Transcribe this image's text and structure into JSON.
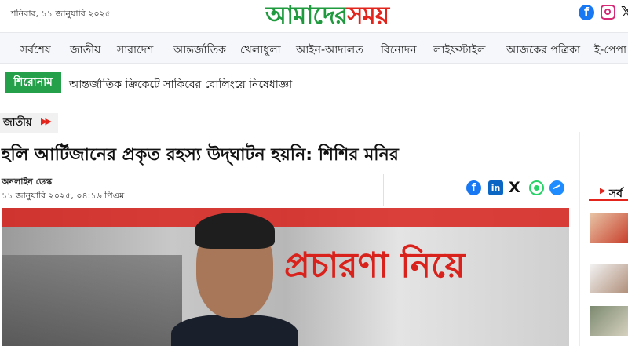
{
  "header": {
    "date": "শনিবার, ১১ জানুয়ারি ২০২৫",
    "logo_part1": "আমাদের",
    "logo_part2": "সময়",
    "social_icons": [
      "facebook-icon",
      "instagram-icon",
      "x-icon"
    ],
    "colors": {
      "logo_green": "#1f9a3e",
      "logo_red": "#e2241c"
    }
  },
  "nav": {
    "items": [
      "সর্বশেষ",
      "জাতীয়",
      "সারাদেশ",
      "আন্তর্জাতিক",
      "খেলাধুলা",
      "আইন-আদালত",
      "বিনোদন",
      "লাইফস্টাইল",
      "আজকের পত্রিকা",
      "ই-পেপা"
    ]
  },
  "ticker": {
    "label": "শিরোনাম",
    "text": "আন্তর্জাতিক ক্রিকেটে সাকিবের বোলিংয়ে নিষেধাজ্ঞা",
    "label_color": "#24a04a"
  },
  "article": {
    "category": "জাতীয়",
    "category_icon": "double-chevron-right-icon",
    "headline": "হলি আর্টিজানের প্রকৃত রহস্য উদ্‌ঘাটন হয়নি: শিশির মনির",
    "author": "অনলাইন ডেস্ক",
    "published": "১১ জানুয়ারি ২০২৫, ০৪:১৬ পিএম",
    "share_icons": [
      "facebook-icon",
      "linkedin-icon",
      "x-icon",
      "whatsapp-icon",
      "messenger-icon"
    ],
    "hero_image_text": "প্রচারণা নিয়ে"
  },
  "sidebar": {
    "heading": "সর্ব",
    "arrow_icon": "caret-right-icon"
  }
}
